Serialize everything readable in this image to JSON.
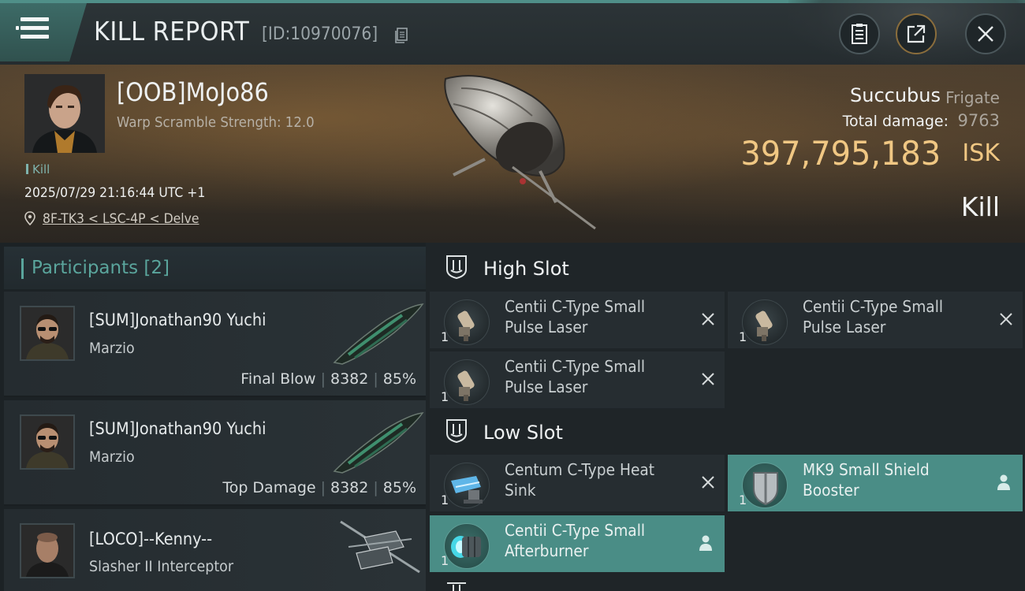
{
  "header": {
    "title": "KILL REPORT",
    "report_id": "[ID:10970076]"
  },
  "victim": {
    "name": "[OOB]MoJo86",
    "warp_scramble": "Warp Scramble Strength: 12.0",
    "kill_tag": "Kill",
    "datetime": "2025/07/29 21:16:44 UTC +1",
    "location": "8F-TK3 < LSC-4P < Delve",
    "ship_name": "Succubus",
    "ship_class": "Frigate",
    "total_damage_label": "Total damage:",
    "total_damage": "9763",
    "isk_value": "397,795,183",
    "isk_unit": "ISK",
    "result": "Kill"
  },
  "participants": {
    "title": "Participants",
    "count": "[2]",
    "rows": [
      {
        "name": "[SUM]Jonathan90 Yuchi",
        "ship": "Marzio",
        "role": "Final Blow",
        "damage": "8382",
        "percent": "85%"
      },
      {
        "name": "[SUM]Jonathan90 Yuchi",
        "ship": "Marzio",
        "role": "Top Damage",
        "damage": "8382",
        "percent": "85%"
      },
      {
        "name": "[LOCO]--Kenny--",
        "ship": "Slasher II Interceptor"
      }
    ]
  },
  "slots": {
    "high": {
      "title": "High Slot",
      "modules": [
        {
          "name": "Centii C-Type Small Pulse Laser",
          "qty": "1",
          "state": "destroyed"
        },
        {
          "name": "Centii C-Type Small Pulse Laser",
          "qty": "1",
          "state": "destroyed"
        },
        {
          "name": "Centii C-Type Small Pulse Laser",
          "qty": "1",
          "state": "destroyed"
        }
      ]
    },
    "low": {
      "title": "Low Slot",
      "modules": [
        {
          "name": "Centum C-Type Heat Sink",
          "qty": "1",
          "state": "destroyed"
        },
        {
          "name": "MK9 Small Shield Booster",
          "qty": "1",
          "state": "dropped"
        },
        {
          "name": "Centii C-Type Small Afterburner",
          "qty": "1",
          "state": "dropped"
        }
      ]
    }
  },
  "colors": {
    "accent": "#4a8d86",
    "isk": "#f0c783",
    "participants_title": "#5aa59c"
  },
  "icons": {
    "menu": "hamburger-icon",
    "copy": "copy-icon",
    "clipboard": "clipboard-icon",
    "share": "share-icon",
    "close": "close-icon",
    "location": "location-pin-icon",
    "slot": "slot-shield-icon",
    "destroyed": "x-icon",
    "dropped": "person-icon"
  }
}
